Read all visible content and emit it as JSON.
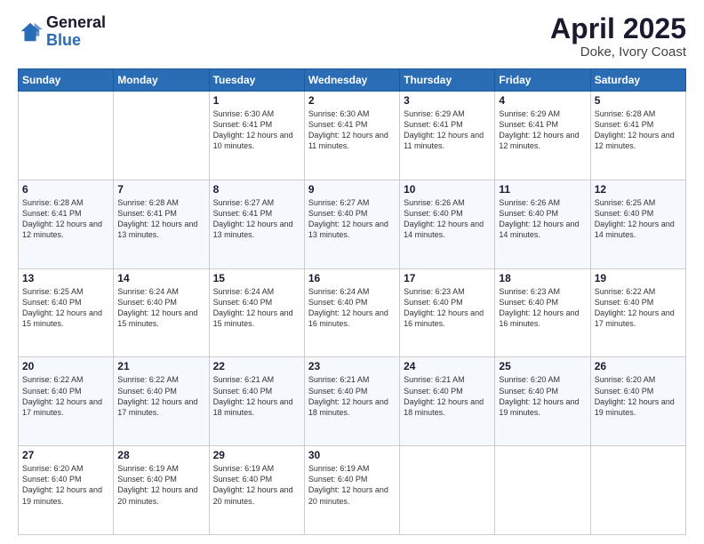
{
  "logo": {
    "general": "General",
    "blue": "Blue"
  },
  "title": {
    "month": "April 2025",
    "location": "Doke, Ivory Coast"
  },
  "days_of_week": [
    "Sunday",
    "Monday",
    "Tuesday",
    "Wednesday",
    "Thursday",
    "Friday",
    "Saturday"
  ],
  "weeks": [
    [
      {
        "day": "",
        "info": ""
      },
      {
        "day": "",
        "info": ""
      },
      {
        "day": "1",
        "info": "Sunrise: 6:30 AM\nSunset: 6:41 PM\nDaylight: 12 hours and 10 minutes."
      },
      {
        "day": "2",
        "info": "Sunrise: 6:30 AM\nSunset: 6:41 PM\nDaylight: 12 hours and 11 minutes."
      },
      {
        "day": "3",
        "info": "Sunrise: 6:29 AM\nSunset: 6:41 PM\nDaylight: 12 hours and 11 minutes."
      },
      {
        "day": "4",
        "info": "Sunrise: 6:29 AM\nSunset: 6:41 PM\nDaylight: 12 hours and 12 minutes."
      },
      {
        "day": "5",
        "info": "Sunrise: 6:28 AM\nSunset: 6:41 PM\nDaylight: 12 hours and 12 minutes."
      }
    ],
    [
      {
        "day": "6",
        "info": "Sunrise: 6:28 AM\nSunset: 6:41 PM\nDaylight: 12 hours and 12 minutes."
      },
      {
        "day": "7",
        "info": "Sunrise: 6:28 AM\nSunset: 6:41 PM\nDaylight: 12 hours and 13 minutes."
      },
      {
        "day": "8",
        "info": "Sunrise: 6:27 AM\nSunset: 6:41 PM\nDaylight: 12 hours and 13 minutes."
      },
      {
        "day": "9",
        "info": "Sunrise: 6:27 AM\nSunset: 6:40 PM\nDaylight: 12 hours and 13 minutes."
      },
      {
        "day": "10",
        "info": "Sunrise: 6:26 AM\nSunset: 6:40 PM\nDaylight: 12 hours and 14 minutes."
      },
      {
        "day": "11",
        "info": "Sunrise: 6:26 AM\nSunset: 6:40 PM\nDaylight: 12 hours and 14 minutes."
      },
      {
        "day": "12",
        "info": "Sunrise: 6:25 AM\nSunset: 6:40 PM\nDaylight: 12 hours and 14 minutes."
      }
    ],
    [
      {
        "day": "13",
        "info": "Sunrise: 6:25 AM\nSunset: 6:40 PM\nDaylight: 12 hours and 15 minutes."
      },
      {
        "day": "14",
        "info": "Sunrise: 6:24 AM\nSunset: 6:40 PM\nDaylight: 12 hours and 15 minutes."
      },
      {
        "day": "15",
        "info": "Sunrise: 6:24 AM\nSunset: 6:40 PM\nDaylight: 12 hours and 15 minutes."
      },
      {
        "day": "16",
        "info": "Sunrise: 6:24 AM\nSunset: 6:40 PM\nDaylight: 12 hours and 16 minutes."
      },
      {
        "day": "17",
        "info": "Sunrise: 6:23 AM\nSunset: 6:40 PM\nDaylight: 12 hours and 16 minutes."
      },
      {
        "day": "18",
        "info": "Sunrise: 6:23 AM\nSunset: 6:40 PM\nDaylight: 12 hours and 16 minutes."
      },
      {
        "day": "19",
        "info": "Sunrise: 6:22 AM\nSunset: 6:40 PM\nDaylight: 12 hours and 17 minutes."
      }
    ],
    [
      {
        "day": "20",
        "info": "Sunrise: 6:22 AM\nSunset: 6:40 PM\nDaylight: 12 hours and 17 minutes."
      },
      {
        "day": "21",
        "info": "Sunrise: 6:22 AM\nSunset: 6:40 PM\nDaylight: 12 hours and 17 minutes."
      },
      {
        "day": "22",
        "info": "Sunrise: 6:21 AM\nSunset: 6:40 PM\nDaylight: 12 hours and 18 minutes."
      },
      {
        "day": "23",
        "info": "Sunrise: 6:21 AM\nSunset: 6:40 PM\nDaylight: 12 hours and 18 minutes."
      },
      {
        "day": "24",
        "info": "Sunrise: 6:21 AM\nSunset: 6:40 PM\nDaylight: 12 hours and 18 minutes."
      },
      {
        "day": "25",
        "info": "Sunrise: 6:20 AM\nSunset: 6:40 PM\nDaylight: 12 hours and 19 minutes."
      },
      {
        "day": "26",
        "info": "Sunrise: 6:20 AM\nSunset: 6:40 PM\nDaylight: 12 hours and 19 minutes."
      }
    ],
    [
      {
        "day": "27",
        "info": "Sunrise: 6:20 AM\nSunset: 6:40 PM\nDaylight: 12 hours and 19 minutes."
      },
      {
        "day": "28",
        "info": "Sunrise: 6:19 AM\nSunset: 6:40 PM\nDaylight: 12 hours and 20 minutes."
      },
      {
        "day": "29",
        "info": "Sunrise: 6:19 AM\nSunset: 6:40 PM\nDaylight: 12 hours and 20 minutes."
      },
      {
        "day": "30",
        "info": "Sunrise: 6:19 AM\nSunset: 6:40 PM\nDaylight: 12 hours and 20 minutes."
      },
      {
        "day": "",
        "info": ""
      },
      {
        "day": "",
        "info": ""
      },
      {
        "day": "",
        "info": ""
      }
    ]
  ]
}
